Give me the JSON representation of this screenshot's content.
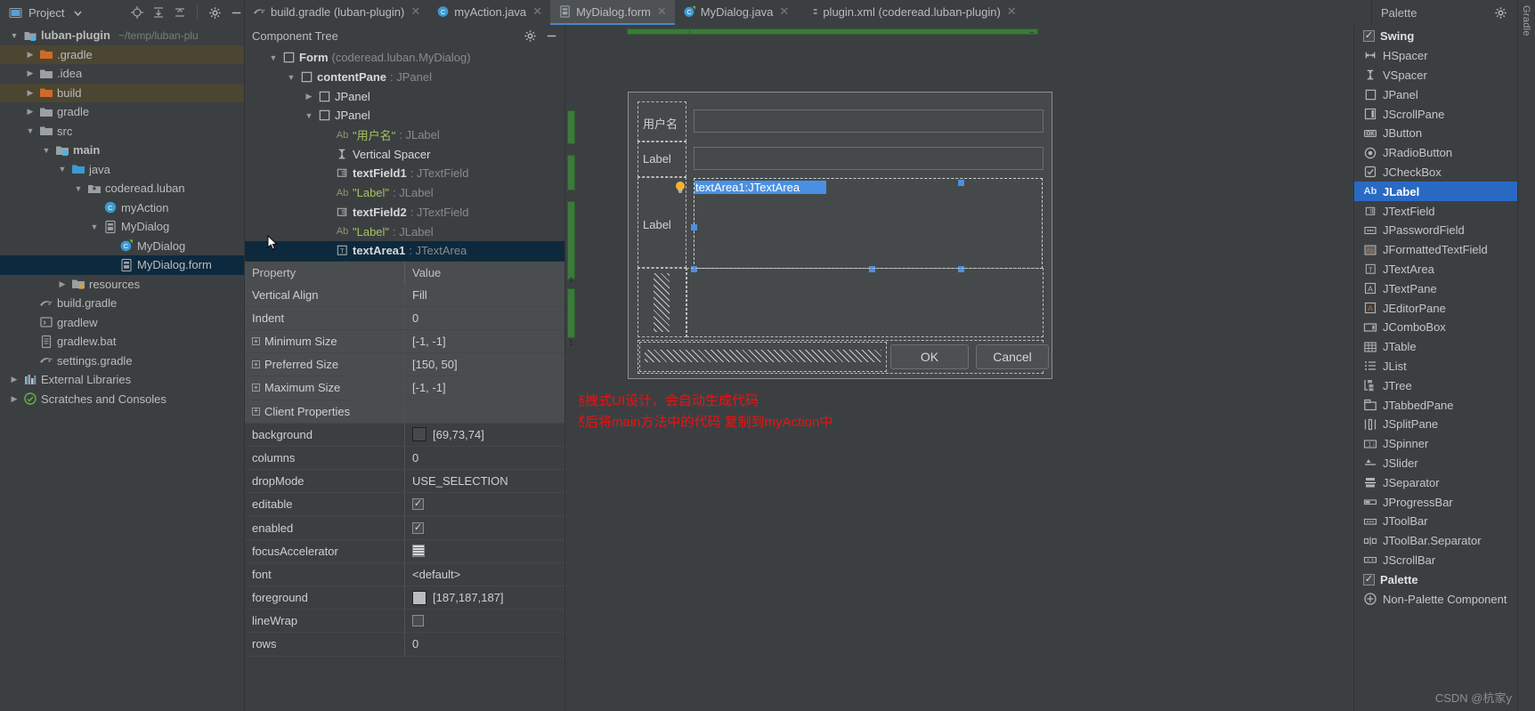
{
  "project_panel": {
    "title": "Project",
    "toolbar_icons": [
      "locate-icon",
      "expand-all-icon",
      "collapse-all-icon",
      "gear-icon",
      "minimize-icon"
    ],
    "root": {
      "label": "luban-plugin",
      "path": "~/temp/luban-plu"
    },
    "items": [
      {
        "label": ".gradle",
        "icon": "folder-orange-icon",
        "indent": 1,
        "arrow": "collapsed",
        "highlight": "mark"
      },
      {
        "label": ".idea",
        "icon": "folder-gray-icon",
        "indent": 1,
        "arrow": "collapsed",
        "highlight": "none"
      },
      {
        "label": "build",
        "icon": "folder-orange-icon",
        "indent": 1,
        "arrow": "collapsed",
        "highlight": "mark"
      },
      {
        "label": "gradle",
        "icon": "folder-gray-icon",
        "indent": 1,
        "arrow": "collapsed",
        "highlight": "none"
      },
      {
        "label": "src",
        "icon": "folder-gray-icon",
        "indent": 1,
        "arrow": "expanded",
        "highlight": "none"
      },
      {
        "label": "main",
        "icon": "folder-source-icon",
        "indent": 2,
        "arrow": "expanded",
        "highlight": "none",
        "bold": true
      },
      {
        "label": "java",
        "icon": "folder-blue-icon",
        "indent": 3,
        "arrow": "expanded",
        "highlight": "none"
      },
      {
        "label": "coderead.luban",
        "icon": "package-icon",
        "indent": 4,
        "arrow": "expanded",
        "highlight": "none"
      },
      {
        "label": "myAction",
        "icon": "class-icon",
        "indent": 5,
        "arrow": "none",
        "highlight": "none"
      },
      {
        "label": "MyDialog",
        "icon": "form-file-icon",
        "indent": 5,
        "arrow": "expanded",
        "highlight": "none"
      },
      {
        "label": "MyDialog",
        "icon": "class-form-icon",
        "indent": 6,
        "arrow": "none",
        "highlight": "none"
      },
      {
        "label": "MyDialog.form",
        "icon": "form-file-icon",
        "indent": 6,
        "arrow": "none",
        "highlight": "selected"
      },
      {
        "label": "resources",
        "icon": "folder-resources-icon",
        "indent": 3,
        "arrow": "collapsed",
        "highlight": "none"
      },
      {
        "label": "build.gradle",
        "icon": "gradle-icon",
        "indent": 1,
        "arrow": "none",
        "highlight": "none"
      },
      {
        "label": "gradlew",
        "icon": "script-icon",
        "indent": 1,
        "arrow": "none",
        "highlight": "none"
      },
      {
        "label": "gradlew.bat",
        "icon": "file-icon",
        "indent": 1,
        "arrow": "none",
        "highlight": "none"
      },
      {
        "label": "settings.gradle",
        "icon": "gradle-icon",
        "indent": 1,
        "arrow": "none",
        "highlight": "none"
      },
      {
        "label": "External Libraries",
        "icon": "libraries-icon",
        "indent": 0,
        "arrow": "collapsed",
        "highlight": "none"
      },
      {
        "label": "Scratches and Consoles",
        "icon": "scratches-icon",
        "indent": 0,
        "arrow": "collapsed",
        "highlight": "none"
      }
    ]
  },
  "editor_tabs": [
    {
      "label": "build.gradle (luban-plugin)",
      "icon": "gradle-icon",
      "active": false,
      "closable": true
    },
    {
      "label": "myAction.java",
      "icon": "class-icon",
      "active": false,
      "closable": true
    },
    {
      "label": "MyDialog.form",
      "icon": "form-file-icon",
      "active": true,
      "closable": true
    },
    {
      "label": "MyDialog.java",
      "icon": "class-form-icon",
      "active": false,
      "closable": true
    },
    {
      "label": "plugin.xml (coderead.luban-plugin)",
      "icon": "plugin-xml-icon",
      "active": false,
      "closable": true
    }
  ],
  "component_tree": {
    "title": "Component Tree",
    "header_icons": [
      "gear-icon",
      "minimize-icon"
    ],
    "nodes": [
      {
        "indent": 1,
        "arrow": "expanded",
        "icon": "panel-icon",
        "name": "Form",
        "type": " (coderead.luban.MyDialog)",
        "bold": true,
        "selected": false
      },
      {
        "indent": 2,
        "arrow": "expanded",
        "icon": "panel-icon",
        "name": "contentPane",
        "type": " : JPanel",
        "bold": true,
        "selected": false
      },
      {
        "indent": 3,
        "arrow": "collapsed",
        "icon": "panel-icon",
        "name": "JPanel",
        "type": "",
        "bold": false,
        "selected": false
      },
      {
        "indent": 3,
        "arrow": "expanded",
        "icon": "panel-icon",
        "name": "JPanel",
        "type": "",
        "bold": false,
        "selected": false
      },
      {
        "indent": 4,
        "arrow": "none",
        "icon": "ab-icon",
        "name": "\"用户名\"",
        "type": " : JLabel",
        "bold": false,
        "literal": true,
        "selected": false
      },
      {
        "indent": 4,
        "arrow": "none",
        "icon": "vspacer-icon",
        "name": "Vertical Spacer",
        "type": "",
        "bold": false,
        "plain": true,
        "selected": false
      },
      {
        "indent": 4,
        "arrow": "none",
        "icon": "textfield-icon",
        "name": "textField1",
        "type": " : JTextField",
        "bold": true,
        "selected": false
      },
      {
        "indent": 4,
        "arrow": "none",
        "icon": "ab-icon",
        "name": "\"Label\"",
        "type": " : JLabel",
        "bold": false,
        "literal": true,
        "selected": false
      },
      {
        "indent": 4,
        "arrow": "none",
        "icon": "textfield-icon",
        "name": "textField2",
        "type": " : JTextField",
        "bold": true,
        "selected": false
      },
      {
        "indent": 4,
        "arrow": "none",
        "icon": "ab-icon",
        "name": "\"Label\"",
        "type": " : JLabel",
        "bold": false,
        "literal": true,
        "selected": false
      },
      {
        "indent": 4,
        "arrow": "none",
        "icon": "textarea-icon",
        "name": "textArea1",
        "type": " : JTextArea",
        "bold": true,
        "selected": true
      }
    ]
  },
  "properties": {
    "col_property": "Property",
    "col_value": "Value",
    "rows": [
      {
        "name": "Vertical Align",
        "value": "Fill",
        "kind": "text",
        "expandable": false,
        "alt": true
      },
      {
        "name": "Indent",
        "value": "0",
        "kind": "text",
        "expandable": false,
        "alt": true
      },
      {
        "name": "Minimum Size",
        "value": "[-1, -1]",
        "kind": "text",
        "expandable": true,
        "alt": true
      },
      {
        "name": "Preferred Size",
        "value": "[150, 50]",
        "kind": "text",
        "expandable": true,
        "alt": true
      },
      {
        "name": "Maximum Size",
        "value": "[-1, -1]",
        "kind": "text",
        "expandable": true,
        "alt": true
      },
      {
        "name": "Client Properties",
        "value": "",
        "kind": "text",
        "expandable": true,
        "alt": true
      },
      {
        "name": "background",
        "value": "[69,73,74]",
        "kind": "color",
        "color": "#45494a",
        "expandable": false,
        "alt": false
      },
      {
        "name": "columns",
        "value": "0",
        "kind": "text",
        "expandable": false,
        "alt": false
      },
      {
        "name": "dropMode",
        "value": "USE_SELECTION",
        "kind": "text",
        "expandable": false,
        "alt": false
      },
      {
        "name": "editable",
        "value": "",
        "kind": "checkbox",
        "checked": true,
        "expandable": false,
        "alt": false
      },
      {
        "name": "enabled",
        "value": "",
        "kind": "checkbox",
        "checked": true,
        "expandable": false,
        "alt": false
      },
      {
        "name": "focusAccelerator",
        "value": "",
        "kind": "lines",
        "expandable": false,
        "alt": false
      },
      {
        "name": "font",
        "value": "<default>",
        "kind": "text",
        "expandable": false,
        "alt": false
      },
      {
        "name": "foreground",
        "value": "[187,187,187]",
        "kind": "color",
        "color": "#bbbbbb",
        "expandable": false,
        "alt": false
      },
      {
        "name": "lineWrap",
        "value": "",
        "kind": "checkbox",
        "checked": false,
        "expandable": false,
        "alt": false
      },
      {
        "name": "rows",
        "value": "0",
        "kind": "text",
        "expandable": false,
        "alt": false
      }
    ]
  },
  "design_form": {
    "labels": {
      "username": "用户名",
      "label2": "Label",
      "label3": "Label"
    },
    "selected_component_text": "textArea1:JTextArea",
    "buttons": [
      {
        "label": "OK",
        "name": "ok-button"
      },
      {
        "label": "Cancel",
        "name": "cancel-button"
      }
    ]
  },
  "annotation": {
    "line1": "拖拽式UI设计，会自动生成代码",
    "line2": "然后将main方法中的代码 复制到myAction中",
    "color": "#ee1111"
  },
  "palette": {
    "title": "Palette",
    "header_icons": [
      "gear-icon",
      "minimize-icon"
    ],
    "groups": [
      {
        "label": "Swing",
        "checked": true,
        "items": [
          {
            "label": "HSpacer",
            "icon": "hspacer-icon"
          },
          {
            "label": "VSpacer",
            "icon": "vspacer-icon"
          },
          {
            "label": "JPanel",
            "icon": "panel-icon"
          },
          {
            "label": "JScrollPane",
            "icon": "scrollpane-icon"
          },
          {
            "label": "JButton",
            "icon": "button-icon"
          },
          {
            "label": "JRadioButton",
            "icon": "radio-icon"
          },
          {
            "label": "JCheckBox",
            "icon": "checkbox-icon"
          },
          {
            "label": "JLabel",
            "icon": "ab-icon",
            "selected": true
          },
          {
            "label": "JTextField",
            "icon": "textfield-icon"
          },
          {
            "label": "JPasswordField",
            "icon": "password-icon"
          },
          {
            "label": "JFormattedTextField",
            "icon": "formatted-icon"
          },
          {
            "label": "JTextArea",
            "icon": "textarea-icon"
          },
          {
            "label": "JTextPane",
            "icon": "textpane-icon"
          },
          {
            "label": "JEditorPane",
            "icon": "editorpane-icon"
          },
          {
            "label": "JComboBox",
            "icon": "combobox-icon"
          },
          {
            "label": "JTable",
            "icon": "table-icon"
          },
          {
            "label": "JList",
            "icon": "list-icon"
          },
          {
            "label": "JTree",
            "icon": "tree-icon"
          },
          {
            "label": "JTabbedPane",
            "icon": "tabbedpane-icon"
          },
          {
            "label": "JSplitPane",
            "icon": "splitpane-icon"
          },
          {
            "label": "JSpinner",
            "icon": "spinner-icon"
          },
          {
            "label": "JSlider",
            "icon": "slider-icon"
          },
          {
            "label": "JSeparator",
            "icon": "separator-icon"
          },
          {
            "label": "JProgressBar",
            "icon": "progressbar-icon"
          },
          {
            "label": "JToolBar",
            "icon": "toolbar-icon"
          },
          {
            "label": "JToolBar.Separator",
            "icon": "toolbar-separator-icon"
          },
          {
            "label": "JScrollBar",
            "icon": "scrollbar-icon"
          }
        ]
      },
      {
        "label": "Palette",
        "checked": true,
        "items": []
      }
    ],
    "footer": {
      "label": "Non-Palette Component",
      "icon": "non-palette-icon"
    }
  },
  "right_strip": {
    "labels": [
      "Gradle"
    ]
  },
  "watermark": "CSDN @杭家у"
}
